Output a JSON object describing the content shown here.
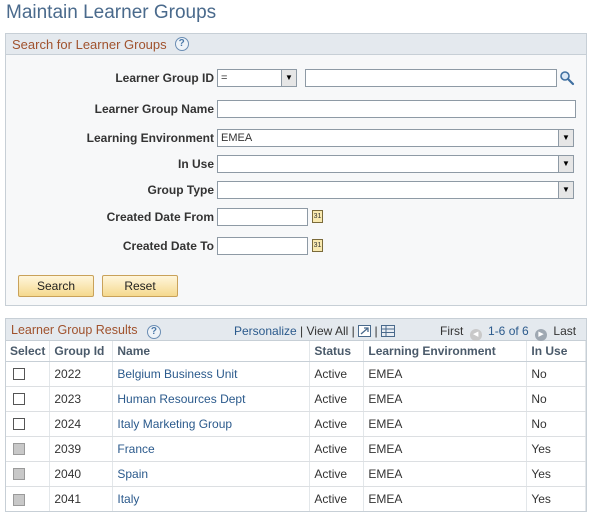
{
  "page": {
    "title": "Maintain Learner Groups"
  },
  "search": {
    "header": "Search for Learner Groups",
    "fields": {
      "group_id": {
        "label": "Learner Group ID",
        "operator": "=",
        "value": ""
      },
      "group_name": {
        "label": "Learner Group Name",
        "value": ""
      },
      "environment": {
        "label": "Learning Environment",
        "value": "EMEA"
      },
      "in_use": {
        "label": "In Use",
        "value": ""
      },
      "group_type": {
        "label": "Group Type",
        "value": ""
      },
      "created_from": {
        "label": "Created Date From",
        "value": ""
      },
      "created_to": {
        "label": "Created Date To",
        "value": ""
      }
    },
    "buttons": {
      "search": "Search",
      "reset": "Reset"
    }
  },
  "results": {
    "title": "Learner Group Results",
    "personalize": "Personalize",
    "separator": "|",
    "view_all": "View All",
    "first": "First",
    "range": "1-6 of 6",
    "last": "Last",
    "columns": [
      "Select",
      "Group Id",
      "Name",
      "Status",
      "Learning Environment",
      "In Use"
    ],
    "rows": [
      {
        "id": "2022",
        "name": "Belgium Business Unit",
        "status": "Active",
        "env": "EMEA",
        "in_use": "No",
        "selectable": true
      },
      {
        "id": "2023",
        "name": "Human Resources Dept",
        "status": "Active",
        "env": "EMEA",
        "in_use": "No",
        "selectable": true
      },
      {
        "id": "2024",
        "name": "Italy Marketing Group",
        "status": "Active",
        "env": "EMEA",
        "in_use": "No",
        "selectable": true
      },
      {
        "id": "2039",
        "name": "France",
        "status": "Active",
        "env": "EMEA",
        "in_use": "Yes",
        "selectable": false
      },
      {
        "id": "2040",
        "name": "Spain",
        "status": "Active",
        "env": "EMEA",
        "in_use": "Yes",
        "selectable": false
      },
      {
        "id": "2041",
        "name": "Italy",
        "status": "Active",
        "env": "EMEA",
        "in_use": "Yes",
        "selectable": false
      }
    ]
  },
  "icons": {
    "help": "help-icon",
    "lookup": "magnifier-icon",
    "calendar": "calendar-icon",
    "zoom": "zoom-grid-icon",
    "download": "download-icon"
  },
  "colors": {
    "title": "#4a6a8c",
    "section_header": "#a0522d",
    "link": "#2b5a8c",
    "button": "#f5d98e"
  }
}
